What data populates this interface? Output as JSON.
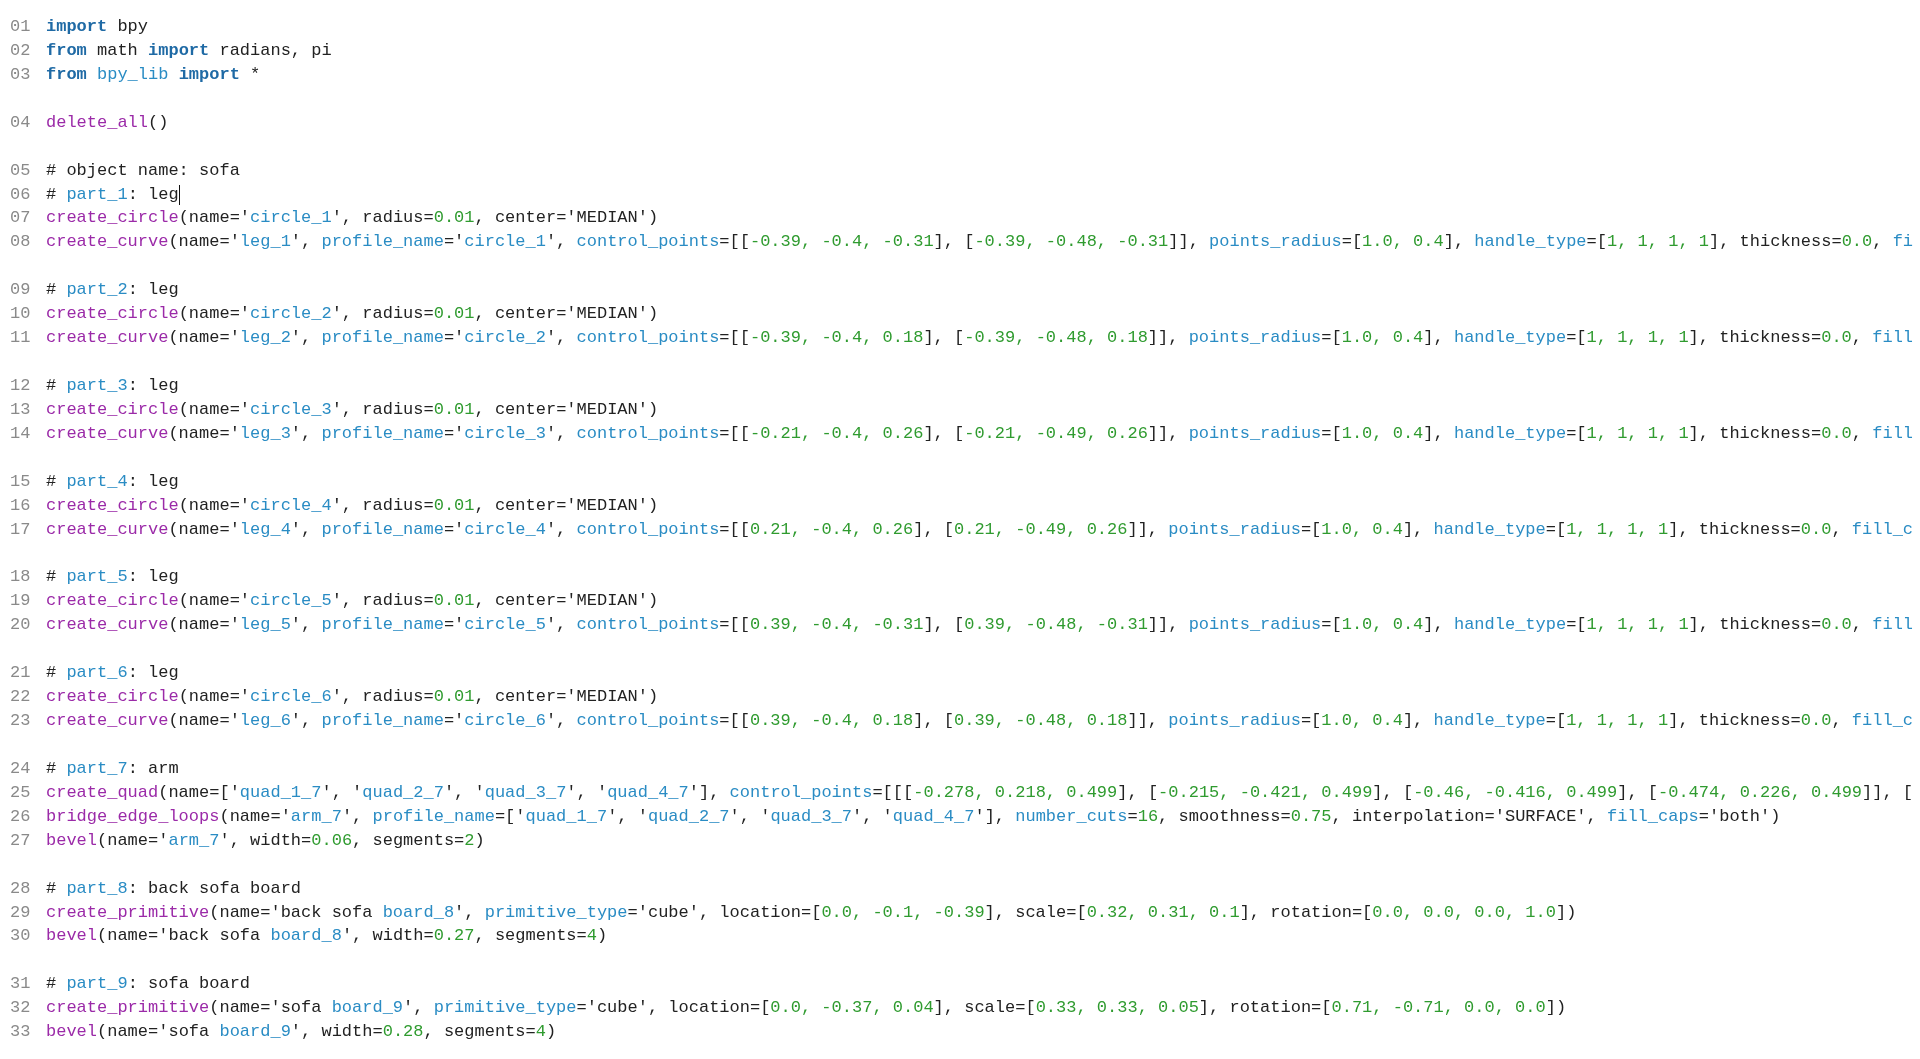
{
  "editor": {
    "groups": [
      {
        "lines": [
          {
            "line_number": "01",
            "tokens": [
              {
                "kind": "keyword",
                "text": "import"
              },
              {
                "kind": "plain",
                "text": " bpy"
              }
            ]
          },
          {
            "line_number": "02",
            "tokens": [
              {
                "kind": "keyword",
                "text": "from"
              },
              {
                "kind": "plain",
                "text": " math "
              },
              {
                "kind": "keyword",
                "text": "import"
              },
              {
                "kind": "plain",
                "text": " radians, pi"
              }
            ]
          },
          {
            "line_number": "03",
            "tokens": [
              {
                "kind": "keyword",
                "text": "from"
              },
              {
                "kind": "name",
                "text": " bpy_lib "
              },
              {
                "kind": "keyword",
                "text": "import"
              },
              {
                "kind": "plain",
                "text": " *"
              }
            ]
          }
        ]
      },
      {
        "lines": [
          {
            "line_number": "04",
            "tokens": [
              {
                "kind": "function",
                "text": "delete_all"
              },
              {
                "kind": "plain",
                "text": "()"
              }
            ]
          }
        ]
      },
      {
        "lines": [
          {
            "line_number": "05",
            "tokens": [
              {
                "kind": "plain",
                "text": "# object name: sofa"
              }
            ]
          },
          {
            "line_number": "06",
            "caret": true,
            "tokens": [
              {
                "kind": "plain",
                "text": "# "
              },
              {
                "kind": "name",
                "text": "part_1"
              },
              {
                "kind": "plain",
                "text": ": leg"
              }
            ]
          },
          {
            "line_number": "07",
            "tokens": [
              {
                "kind": "function",
                "text": "create_circle"
              },
              {
                "kind": "plain",
                "text": "(name='"
              },
              {
                "kind": "name",
                "text": "circle_1"
              },
              {
                "kind": "plain",
                "text": "', radius="
              },
              {
                "kind": "number",
                "text": "0.01"
              },
              {
                "kind": "plain",
                "text": ", center='MEDIAN')"
              }
            ]
          },
          {
            "line_number": "08",
            "tokens": [
              {
                "kind": "function",
                "text": "create_curve"
              },
              {
                "kind": "plain",
                "text": "(name='"
              },
              {
                "kind": "name",
                "text": "leg_1"
              },
              {
                "kind": "plain",
                "text": "', "
              },
              {
                "kind": "name",
                "text": "profile_name"
              },
              {
                "kind": "plain",
                "text": "='"
              },
              {
                "kind": "name",
                "text": "circle_1"
              },
              {
                "kind": "plain",
                "text": "', "
              },
              {
                "kind": "name",
                "text": "control_points"
              },
              {
                "kind": "plain",
                "text": "=[["
              },
              {
                "kind": "number",
                "text": "-0.39, -0.4, -0.31"
              },
              {
                "kind": "plain",
                "text": "], ["
              },
              {
                "kind": "number",
                "text": "-0.39, -0.48, -0.31"
              },
              {
                "kind": "plain",
                "text": "]], "
              },
              {
                "kind": "name",
                "text": "points_radius"
              },
              {
                "kind": "plain",
                "text": "=["
              },
              {
                "kind": "number",
                "text": "1.0, 0.4"
              },
              {
                "kind": "plain",
                "text": "], "
              },
              {
                "kind": "name",
                "text": "handle_type"
              },
              {
                "kind": "plain",
                "text": "=["
              },
              {
                "kind": "number",
                "text": "1, 1, 1, 1"
              },
              {
                "kind": "plain",
                "text": "], thickness="
              },
              {
                "kind": "number",
                "text": "0.0"
              },
              {
                "kind": "plain",
                "text": ", "
              },
              {
                "kind": "name",
                "text": "fi"
              }
            ]
          }
        ]
      },
      {
        "lines": [
          {
            "line_number": "09",
            "tokens": [
              {
                "kind": "plain",
                "text": "# "
              },
              {
                "kind": "name",
                "text": "part_2"
              },
              {
                "kind": "plain",
                "text": ": leg"
              }
            ]
          },
          {
            "line_number": "10",
            "tokens": [
              {
                "kind": "function",
                "text": "create_circle"
              },
              {
                "kind": "plain",
                "text": "(name='"
              },
              {
                "kind": "name",
                "text": "circle_2"
              },
              {
                "kind": "plain",
                "text": "', radius="
              },
              {
                "kind": "number",
                "text": "0.01"
              },
              {
                "kind": "plain",
                "text": ", center='MEDIAN')"
              }
            ]
          },
          {
            "line_number": "11",
            "tokens": [
              {
                "kind": "function",
                "text": "create_curve"
              },
              {
                "kind": "plain",
                "text": "(name='"
              },
              {
                "kind": "name",
                "text": "leg_2"
              },
              {
                "kind": "plain",
                "text": "', "
              },
              {
                "kind": "name",
                "text": "profile_name"
              },
              {
                "kind": "plain",
                "text": "='"
              },
              {
                "kind": "name",
                "text": "circle_2"
              },
              {
                "kind": "plain",
                "text": "', "
              },
              {
                "kind": "name",
                "text": "control_points"
              },
              {
                "kind": "plain",
                "text": "=[["
              },
              {
                "kind": "number",
                "text": "-0.39, -0.4, 0.18"
              },
              {
                "kind": "plain",
                "text": "], ["
              },
              {
                "kind": "number",
                "text": "-0.39, -0.48, 0.18"
              },
              {
                "kind": "plain",
                "text": "]], "
              },
              {
                "kind": "name",
                "text": "points_radius"
              },
              {
                "kind": "plain",
                "text": "=["
              },
              {
                "kind": "number",
                "text": "1.0, 0.4"
              },
              {
                "kind": "plain",
                "text": "], "
              },
              {
                "kind": "name",
                "text": "handle_type"
              },
              {
                "kind": "plain",
                "text": "=["
              },
              {
                "kind": "number",
                "text": "1, 1, 1, 1"
              },
              {
                "kind": "plain",
                "text": "], thickness="
              },
              {
                "kind": "number",
                "text": "0.0"
              },
              {
                "kind": "plain",
                "text": ", "
              },
              {
                "kind": "name",
                "text": "fill"
              }
            ]
          }
        ]
      },
      {
        "lines": [
          {
            "line_number": "12",
            "tokens": [
              {
                "kind": "plain",
                "text": "# "
              },
              {
                "kind": "name",
                "text": "part_3"
              },
              {
                "kind": "plain",
                "text": ": leg"
              }
            ]
          },
          {
            "line_number": "13",
            "tokens": [
              {
                "kind": "function",
                "text": "create_circle"
              },
              {
                "kind": "plain",
                "text": "(name='"
              },
              {
                "kind": "name",
                "text": "circle_3"
              },
              {
                "kind": "plain",
                "text": "', radius="
              },
              {
                "kind": "number",
                "text": "0.01"
              },
              {
                "kind": "plain",
                "text": ", center='MEDIAN')"
              }
            ]
          },
          {
            "line_number": "14",
            "tokens": [
              {
                "kind": "function",
                "text": "create_curve"
              },
              {
                "kind": "plain",
                "text": "(name='"
              },
              {
                "kind": "name",
                "text": "leg_3"
              },
              {
                "kind": "plain",
                "text": "', "
              },
              {
                "kind": "name",
                "text": "profile_name"
              },
              {
                "kind": "plain",
                "text": "='"
              },
              {
                "kind": "name",
                "text": "circle_3"
              },
              {
                "kind": "plain",
                "text": "', "
              },
              {
                "kind": "name",
                "text": "control_points"
              },
              {
                "kind": "plain",
                "text": "=[["
              },
              {
                "kind": "number",
                "text": "-0.21, -0.4, 0.26"
              },
              {
                "kind": "plain",
                "text": "], ["
              },
              {
                "kind": "number",
                "text": "-0.21, -0.49, 0.26"
              },
              {
                "kind": "plain",
                "text": "]], "
              },
              {
                "kind": "name",
                "text": "points_radius"
              },
              {
                "kind": "plain",
                "text": "=["
              },
              {
                "kind": "number",
                "text": "1.0, 0.4"
              },
              {
                "kind": "plain",
                "text": "], "
              },
              {
                "kind": "name",
                "text": "handle_type"
              },
              {
                "kind": "plain",
                "text": "=["
              },
              {
                "kind": "number",
                "text": "1, 1, 1, 1"
              },
              {
                "kind": "plain",
                "text": "], thickness="
              },
              {
                "kind": "number",
                "text": "0.0"
              },
              {
                "kind": "plain",
                "text": ", "
              },
              {
                "kind": "name",
                "text": "fill"
              }
            ]
          }
        ]
      },
      {
        "lines": [
          {
            "line_number": "15",
            "tokens": [
              {
                "kind": "plain",
                "text": "# "
              },
              {
                "kind": "name",
                "text": "part_4"
              },
              {
                "kind": "plain",
                "text": ": leg"
              }
            ]
          },
          {
            "line_number": "16",
            "tokens": [
              {
                "kind": "function",
                "text": "create_circle"
              },
              {
                "kind": "plain",
                "text": "(name='"
              },
              {
                "kind": "name",
                "text": "circle_4"
              },
              {
                "kind": "plain",
                "text": "', radius="
              },
              {
                "kind": "number",
                "text": "0.01"
              },
              {
                "kind": "plain",
                "text": ", center='MEDIAN')"
              }
            ]
          },
          {
            "line_number": "17",
            "tokens": [
              {
                "kind": "function",
                "text": "create_curve"
              },
              {
                "kind": "plain",
                "text": "(name='"
              },
              {
                "kind": "name",
                "text": "leg_4"
              },
              {
                "kind": "plain",
                "text": "', "
              },
              {
                "kind": "name",
                "text": "profile_name"
              },
              {
                "kind": "plain",
                "text": "='"
              },
              {
                "kind": "name",
                "text": "circle_4"
              },
              {
                "kind": "plain",
                "text": "', "
              },
              {
                "kind": "name",
                "text": "control_points"
              },
              {
                "kind": "plain",
                "text": "=[["
              },
              {
                "kind": "number",
                "text": "0.21, -0.4, 0.26"
              },
              {
                "kind": "plain",
                "text": "], ["
              },
              {
                "kind": "number",
                "text": "0.21, -0.49, 0.26"
              },
              {
                "kind": "plain",
                "text": "]], "
              },
              {
                "kind": "name",
                "text": "points_radius"
              },
              {
                "kind": "plain",
                "text": "=["
              },
              {
                "kind": "number",
                "text": "1.0, 0.4"
              },
              {
                "kind": "plain",
                "text": "], "
              },
              {
                "kind": "name",
                "text": "handle_type"
              },
              {
                "kind": "plain",
                "text": "=["
              },
              {
                "kind": "number",
                "text": "1, 1, 1, 1"
              },
              {
                "kind": "plain",
                "text": "], thickness="
              },
              {
                "kind": "number",
                "text": "0.0"
              },
              {
                "kind": "plain",
                "text": ", "
              },
              {
                "kind": "name",
                "text": "fill_c"
              }
            ]
          }
        ]
      },
      {
        "lines": [
          {
            "line_number": "18",
            "tokens": [
              {
                "kind": "plain",
                "text": "# "
              },
              {
                "kind": "name",
                "text": "part_5"
              },
              {
                "kind": "plain",
                "text": ": leg"
              }
            ]
          },
          {
            "line_number": "19",
            "tokens": [
              {
                "kind": "function",
                "text": "create_circle"
              },
              {
                "kind": "plain",
                "text": "(name='"
              },
              {
                "kind": "name",
                "text": "circle_5"
              },
              {
                "kind": "plain",
                "text": "', radius="
              },
              {
                "kind": "number",
                "text": "0.01"
              },
              {
                "kind": "plain",
                "text": ", center='MEDIAN')"
              }
            ]
          },
          {
            "line_number": "20",
            "tokens": [
              {
                "kind": "function",
                "text": "create_curve"
              },
              {
                "kind": "plain",
                "text": "(name='"
              },
              {
                "kind": "name",
                "text": "leg_5"
              },
              {
                "kind": "plain",
                "text": "', "
              },
              {
                "kind": "name",
                "text": "profile_name"
              },
              {
                "kind": "plain",
                "text": "='"
              },
              {
                "kind": "name",
                "text": "circle_5"
              },
              {
                "kind": "plain",
                "text": "', "
              },
              {
                "kind": "name",
                "text": "control_points"
              },
              {
                "kind": "plain",
                "text": "=[["
              },
              {
                "kind": "number",
                "text": "0.39, -0.4, -0.31"
              },
              {
                "kind": "plain",
                "text": "], ["
              },
              {
                "kind": "number",
                "text": "0.39, -0.48, -0.31"
              },
              {
                "kind": "plain",
                "text": "]], "
              },
              {
                "kind": "name",
                "text": "points_radius"
              },
              {
                "kind": "plain",
                "text": "=["
              },
              {
                "kind": "number",
                "text": "1.0, 0.4"
              },
              {
                "kind": "plain",
                "text": "], "
              },
              {
                "kind": "name",
                "text": "handle_type"
              },
              {
                "kind": "plain",
                "text": "=["
              },
              {
                "kind": "number",
                "text": "1, 1, 1, 1"
              },
              {
                "kind": "plain",
                "text": "], thickness="
              },
              {
                "kind": "number",
                "text": "0.0"
              },
              {
                "kind": "plain",
                "text": ", "
              },
              {
                "kind": "name",
                "text": "fill"
              }
            ]
          }
        ]
      },
      {
        "lines": [
          {
            "line_number": "21",
            "tokens": [
              {
                "kind": "plain",
                "text": "# "
              },
              {
                "kind": "name",
                "text": "part_6"
              },
              {
                "kind": "plain",
                "text": ": leg"
              }
            ]
          },
          {
            "line_number": "22",
            "tokens": [
              {
                "kind": "function",
                "text": "create_circle"
              },
              {
                "kind": "plain",
                "text": "(name='"
              },
              {
                "kind": "name",
                "text": "circle_6"
              },
              {
                "kind": "plain",
                "text": "', radius="
              },
              {
                "kind": "number",
                "text": "0.01"
              },
              {
                "kind": "plain",
                "text": ", center='MEDIAN')"
              }
            ]
          },
          {
            "line_number": "23",
            "tokens": [
              {
                "kind": "function",
                "text": "create_curve"
              },
              {
                "kind": "plain",
                "text": "(name='"
              },
              {
                "kind": "name",
                "text": "leg_6"
              },
              {
                "kind": "plain",
                "text": "', "
              },
              {
                "kind": "name",
                "text": "profile_name"
              },
              {
                "kind": "plain",
                "text": "='"
              },
              {
                "kind": "name",
                "text": "circle_6"
              },
              {
                "kind": "plain",
                "text": "', "
              },
              {
                "kind": "name",
                "text": "control_points"
              },
              {
                "kind": "plain",
                "text": "=[["
              },
              {
                "kind": "number",
                "text": "0.39, -0.4, 0.18"
              },
              {
                "kind": "plain",
                "text": "], ["
              },
              {
                "kind": "number",
                "text": "0.39, -0.48, 0.18"
              },
              {
                "kind": "plain",
                "text": "]], "
              },
              {
                "kind": "name",
                "text": "points_radius"
              },
              {
                "kind": "plain",
                "text": "=["
              },
              {
                "kind": "number",
                "text": "1.0, 0.4"
              },
              {
                "kind": "plain",
                "text": "], "
              },
              {
                "kind": "name",
                "text": "handle_type"
              },
              {
                "kind": "plain",
                "text": "=["
              },
              {
                "kind": "number",
                "text": "1, 1, 1, 1"
              },
              {
                "kind": "plain",
                "text": "], thickness="
              },
              {
                "kind": "number",
                "text": "0.0"
              },
              {
                "kind": "plain",
                "text": ", "
              },
              {
                "kind": "name",
                "text": "fill_c"
              }
            ]
          }
        ]
      },
      {
        "lines": [
          {
            "line_number": "24",
            "tokens": [
              {
                "kind": "plain",
                "text": "# "
              },
              {
                "kind": "name",
                "text": "part_7"
              },
              {
                "kind": "plain",
                "text": ": arm"
              }
            ]
          },
          {
            "line_number": "25",
            "tokens": [
              {
                "kind": "function",
                "text": "create_quad"
              },
              {
                "kind": "plain",
                "text": "(name=['"
              },
              {
                "kind": "name",
                "text": "quad_1_7"
              },
              {
                "kind": "plain",
                "text": "', '"
              },
              {
                "kind": "name",
                "text": "quad_2_7"
              },
              {
                "kind": "plain",
                "text": "', '"
              },
              {
                "kind": "name",
                "text": "quad_3_7"
              },
              {
                "kind": "plain",
                "text": "', '"
              },
              {
                "kind": "name",
                "text": "quad_4_7"
              },
              {
                "kind": "plain",
                "text": "'], "
              },
              {
                "kind": "name",
                "text": "control_points"
              },
              {
                "kind": "plain",
                "text": "=[[["
              },
              {
                "kind": "number",
                "text": "-0.278, 0.218, 0.499"
              },
              {
                "kind": "plain",
                "text": "], ["
              },
              {
                "kind": "number",
                "text": "-0.215, -0.421, 0.499"
              },
              {
                "kind": "plain",
                "text": "], ["
              },
              {
                "kind": "number",
                "text": "-0.46, -0.416, 0.499"
              },
              {
                "kind": "plain",
                "text": "], ["
              },
              {
                "kind": "number",
                "text": "-0.474, 0.226, 0.499"
              },
              {
                "kind": "plain",
                "text": "]], ["
              }
            ]
          },
          {
            "line_number": "26",
            "tokens": [
              {
                "kind": "function",
                "text": "bridge_edge_loops"
              },
              {
                "kind": "plain",
                "text": "(name='"
              },
              {
                "kind": "name",
                "text": "arm_7"
              },
              {
                "kind": "plain",
                "text": "', "
              },
              {
                "kind": "name",
                "text": "profile_name"
              },
              {
                "kind": "plain",
                "text": "=['"
              },
              {
                "kind": "name",
                "text": "quad_1_7"
              },
              {
                "kind": "plain",
                "text": "', '"
              },
              {
                "kind": "name",
                "text": "quad_2_7"
              },
              {
                "kind": "plain",
                "text": "', '"
              },
              {
                "kind": "name",
                "text": "quad_3_7"
              },
              {
                "kind": "plain",
                "text": "', '"
              },
              {
                "kind": "name",
                "text": "quad_4_7"
              },
              {
                "kind": "plain",
                "text": "'], "
              },
              {
                "kind": "name",
                "text": "number_cuts"
              },
              {
                "kind": "plain",
                "text": "="
              },
              {
                "kind": "number",
                "text": "16"
              },
              {
                "kind": "plain",
                "text": ", smoothness="
              },
              {
                "kind": "number",
                "text": "0.75"
              },
              {
                "kind": "plain",
                "text": ", interpolation='SURFACE', "
              },
              {
                "kind": "name",
                "text": "fill_caps"
              },
              {
                "kind": "plain",
                "text": "='both')"
              }
            ]
          },
          {
            "line_number": "27",
            "tokens": [
              {
                "kind": "function",
                "text": "bevel"
              },
              {
                "kind": "plain",
                "text": "(name='"
              },
              {
                "kind": "name",
                "text": "arm_7"
              },
              {
                "kind": "plain",
                "text": "', width="
              },
              {
                "kind": "number",
                "text": "0.06"
              },
              {
                "kind": "plain",
                "text": ", segments="
              },
              {
                "kind": "number",
                "text": "2"
              },
              {
                "kind": "plain",
                "text": ")"
              }
            ]
          }
        ]
      },
      {
        "lines": [
          {
            "line_number": "28",
            "tokens": [
              {
                "kind": "plain",
                "text": "# "
              },
              {
                "kind": "name",
                "text": "part_8"
              },
              {
                "kind": "plain",
                "text": ": back sofa board"
              }
            ]
          },
          {
            "line_number": "29",
            "tokens": [
              {
                "kind": "function",
                "text": "create_primitive"
              },
              {
                "kind": "plain",
                "text": "(name='back sofa "
              },
              {
                "kind": "name",
                "text": "board_8"
              },
              {
                "kind": "plain",
                "text": "', "
              },
              {
                "kind": "name",
                "text": "primitive_type"
              },
              {
                "kind": "plain",
                "text": "='cube', location=["
              },
              {
                "kind": "number",
                "text": "0.0, -0.1, -0.39"
              },
              {
                "kind": "plain",
                "text": "], scale=["
              },
              {
                "kind": "number",
                "text": "0.32, 0.31, 0.1"
              },
              {
                "kind": "plain",
                "text": "], rotation=["
              },
              {
                "kind": "number",
                "text": "0.0, 0.0, 0.0, 1.0"
              },
              {
                "kind": "plain",
                "text": "])"
              }
            ]
          },
          {
            "line_number": "30",
            "tokens": [
              {
                "kind": "function",
                "text": "bevel"
              },
              {
                "kind": "plain",
                "text": "(name='back sofa "
              },
              {
                "kind": "name",
                "text": "board_8"
              },
              {
                "kind": "plain",
                "text": "', width="
              },
              {
                "kind": "number",
                "text": "0.27"
              },
              {
                "kind": "plain",
                "text": ", segments="
              },
              {
                "kind": "number",
                "text": "4"
              },
              {
                "kind": "plain",
                "text": ")"
              }
            ]
          }
        ]
      },
      {
        "lines": [
          {
            "line_number": "31",
            "tokens": [
              {
                "kind": "plain",
                "text": "# "
              },
              {
                "kind": "name",
                "text": "part_9"
              },
              {
                "kind": "plain",
                "text": ": sofa board"
              }
            ]
          },
          {
            "line_number": "32",
            "tokens": [
              {
                "kind": "function",
                "text": "create_primitive"
              },
              {
                "kind": "plain",
                "text": "(name='sofa "
              },
              {
                "kind": "name",
                "text": "board_9"
              },
              {
                "kind": "plain",
                "text": "', "
              },
              {
                "kind": "name",
                "text": "primitive_type"
              },
              {
                "kind": "plain",
                "text": "='cube', location=["
              },
              {
                "kind": "number",
                "text": "0.0, -0.37, 0.04"
              },
              {
                "kind": "plain",
                "text": "], scale=["
              },
              {
                "kind": "number",
                "text": "0.33, 0.33, 0.05"
              },
              {
                "kind": "plain",
                "text": "], rotation=["
              },
              {
                "kind": "number",
                "text": "0.71, -0.71, 0.0, 0.0"
              },
              {
                "kind": "plain",
                "text": "])"
              }
            ]
          },
          {
            "line_number": "33",
            "tokens": [
              {
                "kind": "function",
                "text": "bevel"
              },
              {
                "kind": "plain",
                "text": "(name='sofa "
              },
              {
                "kind": "name",
                "text": "board_9"
              },
              {
                "kind": "plain",
                "text": "', width="
              },
              {
                "kind": "number",
                "text": "0.28"
              },
              {
                "kind": "plain",
                "text": ", segments="
              },
              {
                "kind": "number",
                "text": "4"
              },
              {
                "kind": "plain",
                "text": ")"
              }
            ]
          }
        ]
      }
    ]
  }
}
